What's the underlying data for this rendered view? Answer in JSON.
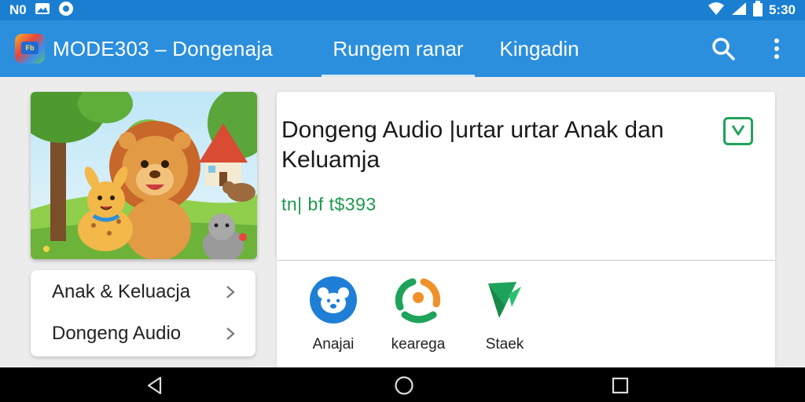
{
  "status_bar": {
    "left_text": "N0",
    "time": "5:30"
  },
  "app_bar": {
    "logo_text": "Fb",
    "title": "MODE303 –  Dongenaja",
    "tabs": [
      {
        "label": "Rungem ranar",
        "active": true
      },
      {
        "label": "Kingadin",
        "active": false
      }
    ],
    "search_icon": "search-icon",
    "more_icon": "more-vert-icon"
  },
  "sidebar": {
    "items": [
      {
        "label": "Anak & Keluacja"
      },
      {
        "label": "Dongeng Audio"
      }
    ]
  },
  "detail": {
    "title": "Dongeng Audio  |urtar urtar Anak dan Keluamja",
    "meta": "tn| bf t$393",
    "badge_icon": "download-check-icon"
  },
  "actions": [
    {
      "label": "Anajai",
      "icon": "bear-icon",
      "color": "#1f7fd6"
    },
    {
      "label": "kearega",
      "icon": "family-icon",
      "color": "#1ea35a"
    },
    {
      "label": "Staek",
      "icon": "share-icon",
      "color": "#1ea35a"
    }
  ],
  "colors": {
    "status_bar": "#1a7fd0",
    "app_bar": "#2b8fde",
    "accent_green": "#22a25c"
  }
}
